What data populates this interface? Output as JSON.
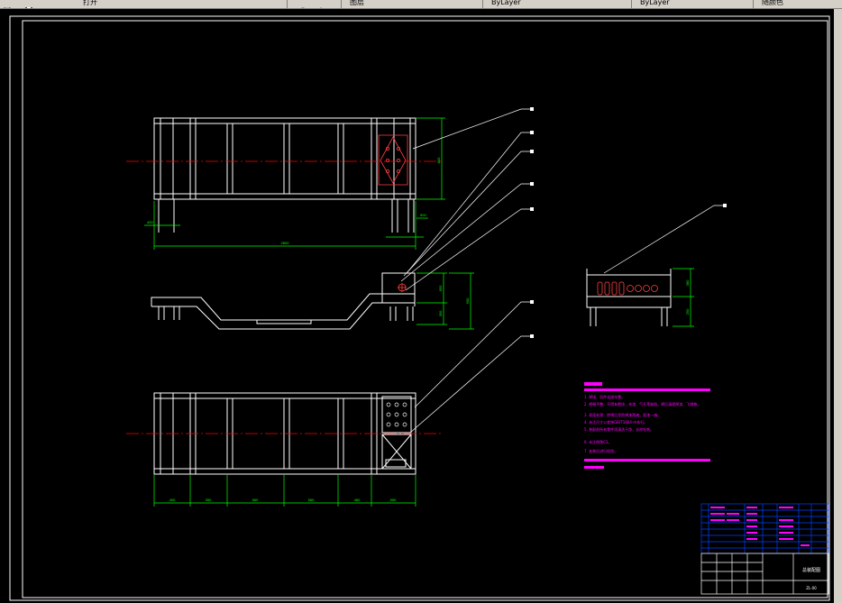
{
  "toolbar": {
    "items": [
      {
        "name": "open-file-button",
        "label": "打开"
      },
      {
        "name": "layer-dropdown",
        "label": "图层"
      },
      {
        "name": "linetype-dropdown",
        "label": "ByLayer"
      },
      {
        "name": "lineweight-dropdown",
        "label": "ByLayer"
      },
      {
        "name": "color-dropdown",
        "label": "ByLayer"
      },
      {
        "name": "plotstyle-dropdown",
        "label": "随颜色"
      }
    ]
  },
  "drawing": {
    "background": "#000000",
    "colors": {
      "geometry": "#ffffff",
      "dimension": "#00ff00",
      "centerline": "#ff0000",
      "notes": "#ff00ff",
      "titleblock": "#0000ff",
      "leader": "#ffffff",
      "detail": "#ff4040"
    },
    "top_view": {
      "dimensions": [
        "2800",
        "400",
        "500",
        "800"
      ]
    },
    "front_view": {
      "dimensions": [
        "650",
        "900",
        "350"
      ]
    },
    "bottom_view": {
      "dimensions": [
        "400",
        "350",
        "560",
        "560",
        "460",
        "550",
        "300"
      ]
    },
    "side_view": {
      "dimensions": [
        "380",
        "250",
        "620"
      ]
    },
    "notes": {
      "heading": "技术要求",
      "lines": [
        "1.  焊接、扣件连接牢靠。",
        "2.  焊缝平整，不得有裂纹、夹渣、气孔等缺陷。焊后清理焊渣、飞溅物。",
        "3.  表面处理：除锈后涂防锈漆两遍，面漆一遍。",
        "4.  未注尺寸公差按GB/T1804-m执行。",
        "5.  装配前所有零件须清洗干净，去除毛刺。",
        "6.  未注倒角C1。",
        "7.  安装后进行检验。"
      ]
    },
    "titleblock": {
      "title": "总装配图",
      "drawing_no": "ZL-00"
    }
  }
}
